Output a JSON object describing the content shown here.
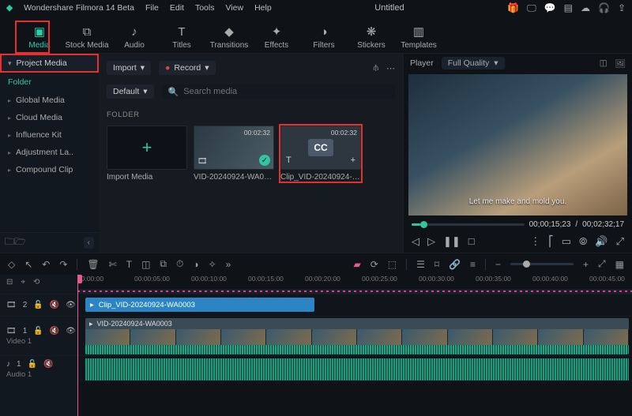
{
  "app": {
    "name": "Wondershare Filmora 14 Beta",
    "doc": "Untitled"
  },
  "menu": [
    "File",
    "Edit",
    "Tools",
    "View",
    "Help"
  ],
  "tabs": [
    {
      "key": "media",
      "label": "Media",
      "icon": "▣"
    },
    {
      "key": "stock",
      "label": "Stock Media",
      "icon": "⧉"
    },
    {
      "key": "audio",
      "label": "Audio",
      "icon": "♪"
    },
    {
      "key": "titles",
      "label": "Titles",
      "icon": "T"
    },
    {
      "key": "transitions",
      "label": "Transitions",
      "icon": "◆"
    },
    {
      "key": "effects",
      "label": "Effects",
      "icon": "✦"
    },
    {
      "key": "filters",
      "label": "Filters",
      "icon": "◑"
    },
    {
      "key": "stickers",
      "label": "Stickers",
      "icon": "❋"
    },
    {
      "key": "templates",
      "label": "Templates",
      "icon": "▥"
    }
  ],
  "sidebar": {
    "project_media": "Project Media",
    "folder_label": "Folder",
    "items": [
      "Global Media",
      "Cloud Media",
      "Influence Kit",
      "Adjustment La..",
      "Compound Clip"
    ]
  },
  "center": {
    "import_label": "Import",
    "record_label": "Record",
    "default_label": "Default",
    "search_placeholder": "Search media",
    "folder_header": "FOLDER",
    "import_media": "Import Media",
    "clip1": {
      "name": "VID-20240924-WA0003",
      "duration": "00:02:32"
    },
    "clip2": {
      "name": "Clip_VID-20240924-W...",
      "duration": "00:02:32",
      "badge": "CC"
    }
  },
  "preview": {
    "player_label": "Player",
    "quality_label": "Full Quality",
    "subtitle": "Let me make and mold you.",
    "time_current": "00;00;15;23",
    "time_total": "00;02;32;17"
  },
  "timeline": {
    "ruler": [
      "00:00:00",
      "00:00:05:00",
      "00:00:10:00",
      "00:00:15:00",
      "00:00:20:00",
      "00:00:25:00",
      "00:00:30:00",
      "00:00:35:00",
      "00:00:40:00",
      "00:00:45:00"
    ],
    "cc_clip": "Clip_VID-20240924-WA0003",
    "vid_clip": "VID-20240924-WA0003",
    "track_video": "Video 1",
    "track_audio": "Audio 1"
  }
}
